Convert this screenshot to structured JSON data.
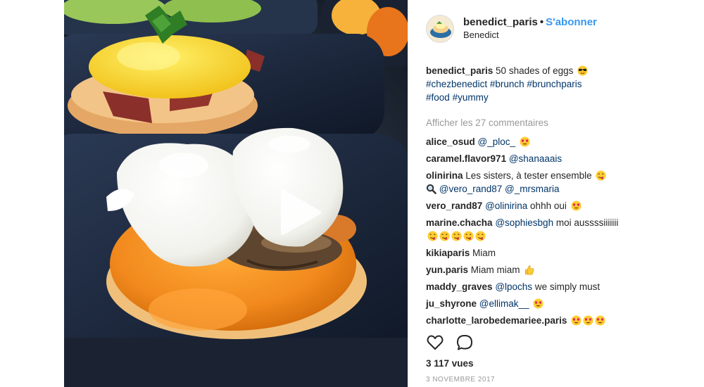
{
  "post": {
    "username": "benedict_paris",
    "separator": "•",
    "follow_label": "S'abonner",
    "location": "Benedict",
    "caption": {
      "username": "benedict_paris",
      "text": " 50 shades of eggs ",
      "emoji": "sunglasses-emoji",
      "hashtags": [
        "#chezbenedict",
        "#brunch",
        "#brunchparis",
        "#food",
        "#yummy"
      ]
    },
    "view_all_comments": "Afficher les 27 commentaires",
    "comments": [
      {
        "user": "alice_osud",
        "text": "",
        "mention": "@_ploc_",
        "after": "",
        "emojis": [
          "heart-eyes-emoji"
        ]
      },
      {
        "user": "caramel.flavor971",
        "text": "",
        "mention": "@shanaaais",
        "after": "",
        "emojis": []
      },
      {
        "user": "olinirina",
        "text": " Les sisters, à tester ensemble ",
        "mention": "",
        "after": "",
        "emojis": [
          "yum-emoji"
        ],
        "line2_emoji": "magnifier-emoji",
        "line2_mentions": [
          "@vero_rand87",
          "@_mrsmaria"
        ]
      },
      {
        "user": "vero_rand87",
        "text": "",
        "mention": "@olinirina",
        "after": " ohhh oui ",
        "emojis": [
          "heart-eyes-emoji"
        ]
      },
      {
        "user": "marine.chacha",
        "text": "",
        "mention": "@sophiesbgh",
        "after": " moi aussssiiiiiii",
        "emojis": [
          "yum-emoji",
          "yum-emoji",
          "yum-emoji",
          "yum-emoji",
          "yum-emoji"
        ]
      },
      {
        "user": "kikiaparis",
        "text": " Miam",
        "mention": "",
        "after": "",
        "emojis": []
      },
      {
        "user": "yun.paris",
        "text": " Miam miam ",
        "mention": "",
        "after": "",
        "emojis": [
          "thumbs-up-emoji"
        ]
      },
      {
        "user": "maddy_graves",
        "text": "",
        "mention": "@lpochs",
        "after": " we simply must",
        "emojis": []
      },
      {
        "user": "ju_shyrone",
        "text": "",
        "mention": "@ellimak__",
        "after": " ",
        "emojis": [
          "heart-eyes-emoji"
        ]
      },
      {
        "user": "charlotte_larobedemariee.paris",
        "text": " ",
        "mention": "",
        "after": "",
        "emojis": [
          "heart-eyes-emoji",
          "heart-eyes-emoji",
          "heart-eyes-emoji"
        ]
      }
    ],
    "views": "3 117 vues",
    "date": "3 NOVEMBRE 2017",
    "icons": {
      "like": "heart-outline-icon",
      "comment": "speech-bubble-icon",
      "play": "play-icon"
    },
    "colors": {
      "link_blue": "#3897f0",
      "mention_blue": "#003569",
      "muted": "#999999",
      "text": "#262626"
    }
  }
}
